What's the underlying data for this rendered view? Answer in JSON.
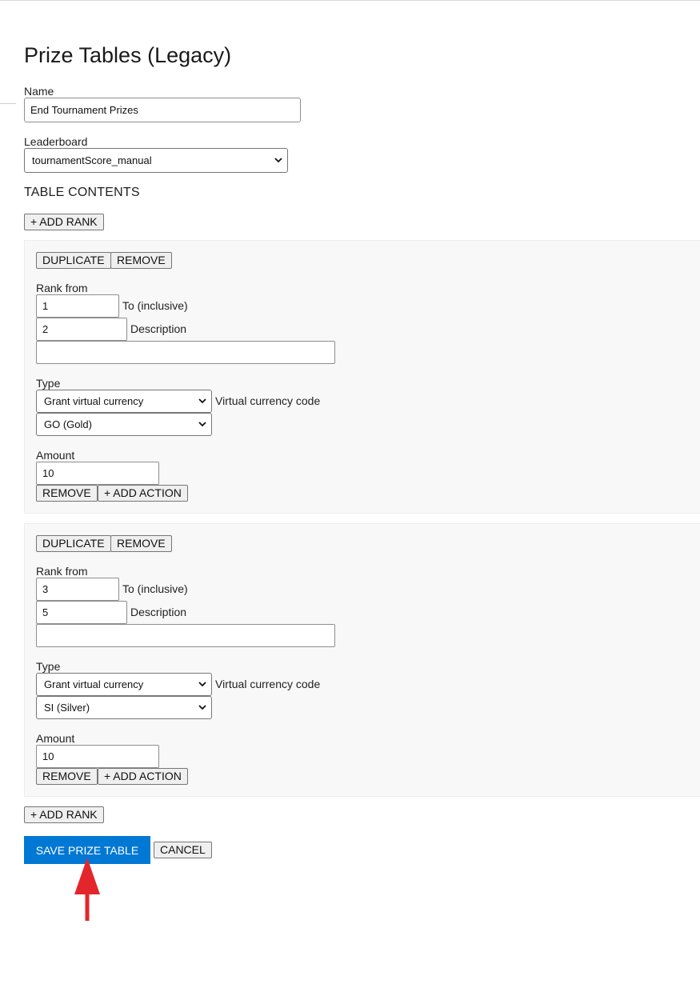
{
  "page": {
    "title": "Prize Tables (Legacy)"
  },
  "form": {
    "name_label": "Name",
    "name_value": "End Tournament Prizes",
    "leaderboard_label": "Leaderboard",
    "leaderboard_value": "tournamentScore_manual",
    "table_contents_label": "TABLE CONTENTS",
    "add_rank_label": "+ ADD RANK"
  },
  "ranks": [
    {
      "duplicate_label": "DUPLICATE",
      "remove_label": "REMOVE",
      "rank_from_label": "Rank from",
      "rank_from": "1",
      "to_label": "To (inclusive)",
      "rank_to": "2",
      "description_label": "Description",
      "description": "",
      "type_label": "Type",
      "type_value": "Grant virtual currency",
      "currency_label": "Virtual currency code",
      "currency_value": "GO (Gold)",
      "amount_label": "Amount",
      "amount": "10",
      "remove_action_label": "REMOVE",
      "add_action_label": "+ ADD ACTION"
    },
    {
      "duplicate_label": "DUPLICATE",
      "remove_label": "REMOVE",
      "rank_from_label": "Rank from",
      "rank_from": "3",
      "to_label": "To (inclusive)",
      "rank_to": "5",
      "description_label": "Description",
      "description": "",
      "type_label": "Type",
      "type_value": "Grant virtual currency",
      "currency_label": "Virtual currency code",
      "currency_value": "SI (Silver)",
      "amount_label": "Amount",
      "amount": "10",
      "remove_action_label": "REMOVE",
      "add_action_label": "+ ADD ACTION"
    }
  ],
  "footer": {
    "add_rank_label": "+ ADD RANK",
    "save_label": "SAVE PRIZE TABLE",
    "cancel_label": "CANCEL"
  },
  "colors": {
    "primary": "#0078d4",
    "annotation_arrow": "#e3262b",
    "card_background": "#f8f8f8"
  },
  "icons": {
    "select_chevron": "chevron-down-icon",
    "annotation": "red-arrow-up-icon"
  }
}
